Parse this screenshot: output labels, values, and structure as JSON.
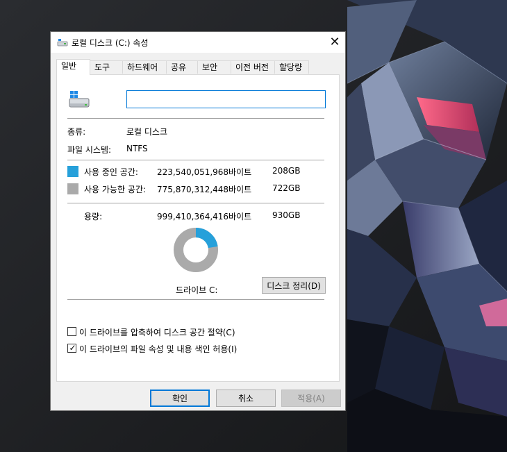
{
  "window": {
    "title": "로컬 디스크 (C:) 속성",
    "close_glyph": "✕"
  },
  "tabs": [
    {
      "label": "일반",
      "active": true
    },
    {
      "label": "도구"
    },
    {
      "label": "하드웨어"
    },
    {
      "label": "공유"
    },
    {
      "label": "보안"
    },
    {
      "label": "이전 버전"
    },
    {
      "label": "할당량"
    }
  ],
  "general": {
    "drive_name_value": "",
    "type_label": "종류:",
    "type_value": "로컬 디스크",
    "fs_label": "파일 시스템:",
    "fs_value": "NTFS",
    "used": {
      "label": "사용 중인 공간:",
      "bytes": "223,540,051,968바이트",
      "size": "208GB",
      "color": "#26a0da"
    },
    "free": {
      "label": "사용 가능한 공간:",
      "bytes": "775,870,312,448바이트",
      "size": "722GB",
      "color": "#aaaaaa"
    },
    "capacity": {
      "label": "용량:",
      "bytes": "999,410,364,416바이트",
      "size": "930GB"
    },
    "used_fraction": 0.2237,
    "drive_caption": "드라이브 C:",
    "cleanup_button": "디스크 정리(D)",
    "compress_checkbox": {
      "label": "이 드라이브를 압축하여 디스크 공간 절약(C)",
      "checked": false
    },
    "index_checkbox": {
      "label": "이 드라이브의 파일 속성 및 내용 색인 허용(I)",
      "checked": true
    }
  },
  "buttons": {
    "ok": "확인",
    "cancel": "취소",
    "apply": "적용(A)"
  },
  "icons": {
    "title": "drive-icon",
    "drive": "windows-drive-icon",
    "close": "close-icon"
  }
}
